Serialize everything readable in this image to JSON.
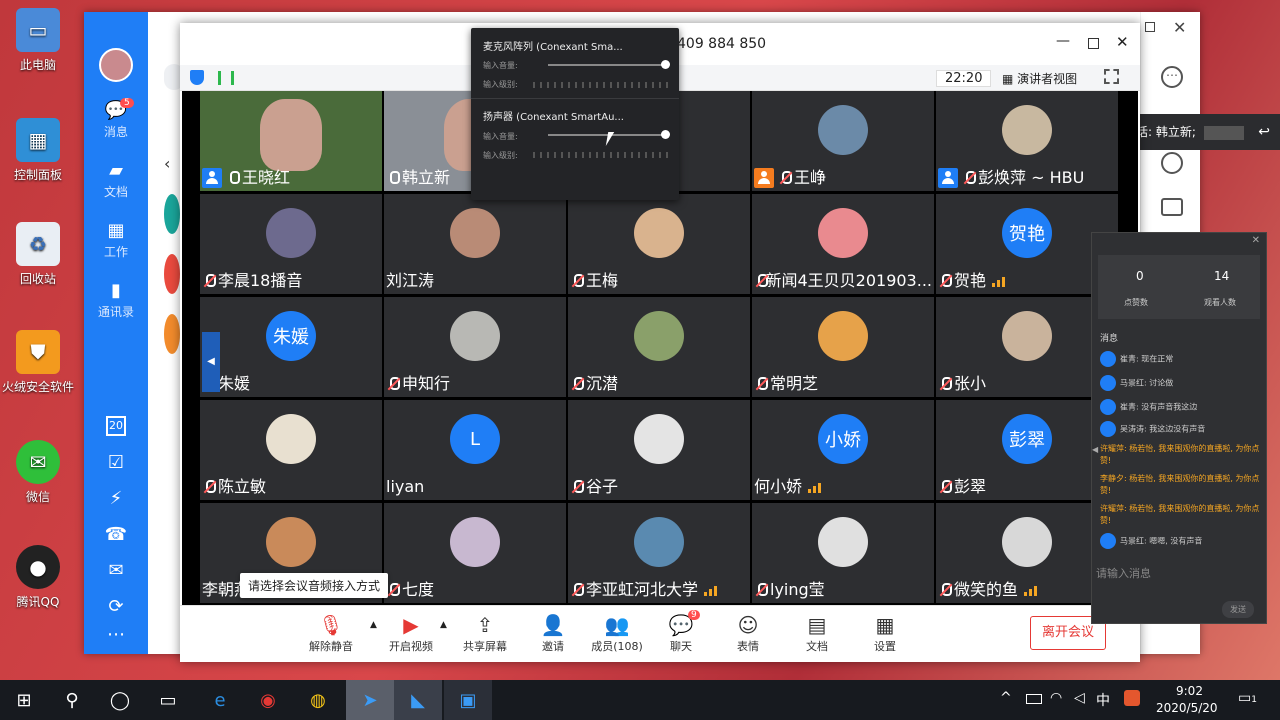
{
  "desktop": {
    "icons": [
      {
        "label": "此电脑",
        "icon": "computer-icon"
      },
      {
        "label": "控制面板",
        "icon": "control-panel-icon"
      },
      {
        "label": "回收站",
        "icon": "recycle-bin-icon"
      },
      {
        "label": "火绒安全软件",
        "icon": "huorong-icon"
      },
      {
        "label": "微信",
        "icon": "wechat-icon"
      },
      {
        "label": "腾讯QQ",
        "icon": "qq-icon"
      }
    ]
  },
  "im_app": {
    "nav": [
      {
        "label": "消息",
        "badge": "5"
      },
      {
        "label": "文档"
      },
      {
        "label": "工作"
      },
      {
        "label": "通讯录"
      }
    ],
    "calendar_day": "20"
  },
  "meeting": {
    "title_fragment": "409 884 850",
    "time": "22:20",
    "view_mode": "演讲者视图",
    "accent": "#1f7ef6",
    "participants": [
      {
        "name": "王晓红",
        "host": true,
        "mic": "on",
        "avatar": "photo",
        "color": "#4a6b3a"
      },
      {
        "name": "韩立新",
        "mic": "on",
        "avatar": "photo",
        "color": "#8a8f96"
      },
      {
        "name": "",
        "mic": "none",
        "avatar": "none",
        "color": "#2d2e31"
      },
      {
        "name": "王峥",
        "host_orange": true,
        "mic": "muted",
        "avatar": "photo",
        "color": "#6b8aa8"
      },
      {
        "name": "彭焕萍 ~ HBU",
        "host": true,
        "mic": "muted",
        "avatar": "photo",
        "color": "#c8b8a0"
      },
      {
        "name": "李晨18播音",
        "mic": "muted",
        "avatar": "photo",
        "color": "#6d6a8e"
      },
      {
        "name": "刘江涛",
        "mic": "none",
        "avatar": "photo",
        "color": "#b98b76"
      },
      {
        "name": "王梅",
        "mic": "muted",
        "avatar": "photo",
        "color": "#d9b38e"
      },
      {
        "name": "新闻4王贝贝201903...",
        "mic": "muted",
        "avatar": "photo",
        "color": "#e98a8f"
      },
      {
        "name": "贺艳",
        "mic": "muted",
        "avatar": "text",
        "initials": "贺艳",
        "signal": true,
        "color": "#1f7ef6"
      },
      {
        "name": "朱媛",
        "mic": "muted",
        "avatar": "text",
        "initials": "朱媛",
        "color": "#1f7ef6"
      },
      {
        "name": "申知行",
        "mic": "muted",
        "avatar": "photo",
        "color": "#b8b8b4"
      },
      {
        "name": "沉潜",
        "mic": "muted",
        "avatar": "photo",
        "color": "#8aa06a"
      },
      {
        "name": "常明芝",
        "mic": "muted",
        "avatar": "photo",
        "color": "#e6a24a"
      },
      {
        "name": "张小",
        "mic": "muted",
        "avatar": "photo",
        "color": "#c9b39c"
      },
      {
        "name": "陈立敏",
        "mic": "muted",
        "avatar": "photo",
        "color": "#e8e0d0"
      },
      {
        "name": "liyan",
        "mic": "none",
        "avatar": "text",
        "initials": "L",
        "color": "#1f7ef6"
      },
      {
        "name": "谷子",
        "mic": "muted",
        "avatar": "photo",
        "color": "#e4e4e4"
      },
      {
        "name": "何小娇",
        "mic": "none",
        "avatar": "text",
        "initials": "小娇",
        "signal": true,
        "color": "#1f7ef6"
      },
      {
        "name": "彭翠",
        "mic": "muted",
        "avatar": "text",
        "initials": "彭翠",
        "color": "#1f7ef6"
      },
      {
        "name": "李朝燕",
        "mic": "none",
        "avatar": "photo",
        "color": "#c98a5a"
      },
      {
        "name": "七度",
        "mic": "muted",
        "avatar": "photo",
        "color": "#c8b8d0"
      },
      {
        "name": "李亚虹河北大学",
        "mic": "muted",
        "avatar": "photo",
        "signal": true,
        "color": "#5a8ab0"
      },
      {
        "name": "lying莹",
        "mic": "muted",
        "avatar": "photo",
        "color": "#e0e0e0"
      },
      {
        "name": "微笑的鱼",
        "mic": "muted",
        "avatar": "photo",
        "signal": true,
        "color": "#d8d8d8"
      }
    ],
    "audio_popup": {
      "mic_title": "麦克风阵列 (Conexant Sma...",
      "mic_volume_label": "输入音量:",
      "mic_level_label": "输入级别:",
      "speaker_title": "扬声器 (Conexant SmartAu...",
      "speaker_volume_label": "输入音量:",
      "speaker_level_label": "输入级别:"
    },
    "tooltip": "请选择会议音频接入方式",
    "toolbar": [
      {
        "label": "解除静音",
        "icon": "mic-muted-icon"
      },
      {
        "label": "开启视频",
        "icon": "video-off-icon"
      },
      {
        "label": "共享屏幕",
        "icon": "share-screen-icon"
      },
      {
        "label": "邀请",
        "icon": "invite-icon"
      },
      {
        "label": "成员(108)",
        "icon": "members-icon"
      },
      {
        "label": "聊天",
        "icon": "chat-icon",
        "badge": "9"
      },
      {
        "label": "表情",
        "icon": "emoji-icon"
      },
      {
        "label": "文档",
        "icon": "doc-icon"
      },
      {
        "label": "设置",
        "icon": "settings-icon"
      }
    ],
    "leave_label": "离开会议"
  },
  "speaking": {
    "prefix": "正在讲话:",
    "name": "韩立新;"
  },
  "chat_panel": {
    "likes": "0",
    "likes_label": "点赞数",
    "viewers": "14",
    "viewers_label": "观看人数",
    "section_label": "消息",
    "messages": [
      {
        "text": "崔青: 现在正常",
        "hl": false
      },
      {
        "text": "马景红: 讨论做",
        "hl": false
      },
      {
        "text": "崔青: 没有声音我这边",
        "hl": false
      },
      {
        "text": "吴涛涛: 我这边没有声音",
        "hl": false
      },
      {
        "text": "许耀萍: 杨若怡, 我来围观你的直播啦, 为你点赞!",
        "hl": true
      },
      {
        "text": "李静夕: 杨若怡, 我来围观你的直播啦, 为你点赞!",
        "hl": true
      },
      {
        "text": "许耀萍: 杨若怡, 我来围观你的直播啦, 为你点赞!",
        "hl": true
      },
      {
        "text": "马景红: 嗯嗯, 没有声音",
        "hl": false
      }
    ],
    "input_placeholder": "请输入消息",
    "send_label": "发送"
  },
  "taskbar": {
    "ime": "中",
    "time": "9:02",
    "date": "2020/5/20",
    "notification_count": "1"
  }
}
